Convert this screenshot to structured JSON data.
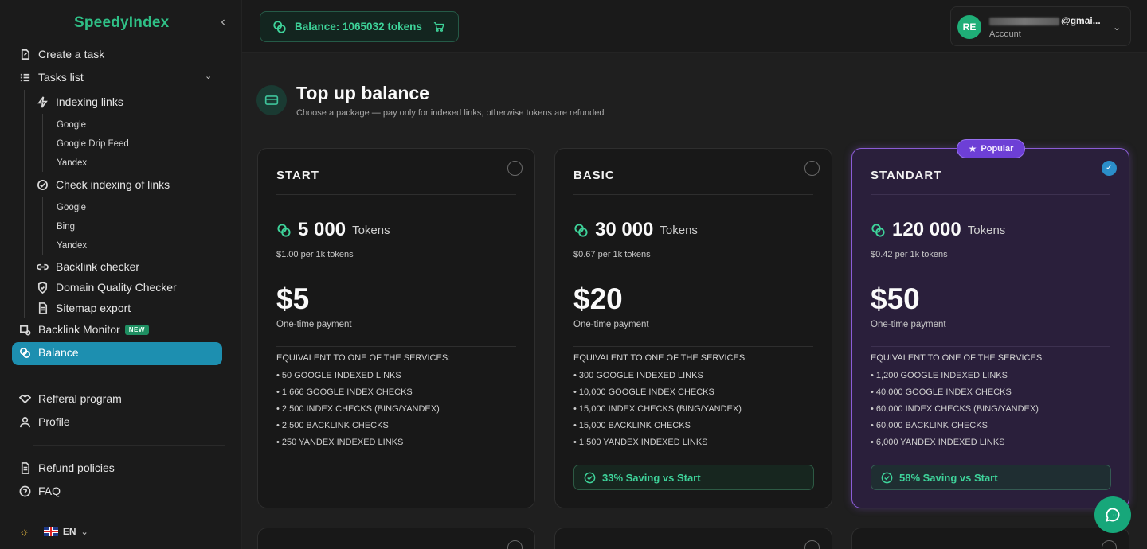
{
  "app": {
    "logo": "SpeedyIndex"
  },
  "sidebar": {
    "create_task": "Create a task",
    "tasks_list": "Tasks list",
    "indexing_links": "Indexing links",
    "indexing_sub": [
      "Google",
      "Google Drip Feed",
      "Yandex"
    ],
    "check_indexing": "Check indexing of links",
    "check_sub": [
      "Google",
      "Bing",
      "Yandex"
    ],
    "backlink_checker": "Backlink checker",
    "domain_quality": "Domain Quality Checker",
    "sitemap_export": "Sitemap export",
    "backlink_monitor": "Backlink Monitor",
    "new_badge": "NEW",
    "balance": "Balance",
    "referral": "Refferal program",
    "profile": "Profile",
    "refund": "Refund policies",
    "faq": "FAQ",
    "language": "EN"
  },
  "header": {
    "balance_label": "Balance: 1065032 tokens",
    "account_avatar": "RE",
    "account_email": "@gmai...",
    "account_label": "Account"
  },
  "page": {
    "title": "Top up balance",
    "subtitle": "Choose a package — pay only for indexed links, otherwise tokens are refunded"
  },
  "packages": [
    {
      "name": "START",
      "tokens": "5 000",
      "tokens_unit": "Tokens",
      "per": "$1.00 per 1k tokens",
      "price": "$5",
      "payment": "One-time payment",
      "equiv_head": "EQUIVALENT TO ONE OF THE SERVICES:",
      "items": [
        "• 50 GOOGLE INDEXED LINKS",
        "• 1,666 GOOGLE INDEX CHECKS",
        "• 2,500 INDEX CHECKS (BING/YANDEX)",
        "• 2,500 BACKLINK CHECKS",
        "• 250 YANDEX INDEXED LINKS"
      ],
      "selected": false
    },
    {
      "name": "BASIC",
      "tokens": "30 000",
      "tokens_unit": "Tokens",
      "per": "$0.67 per 1k tokens",
      "price": "$20",
      "payment": "One-time payment",
      "equiv_head": "EQUIVALENT TO ONE OF THE SERVICES:",
      "items": [
        "• 300 GOOGLE INDEXED LINKS",
        "• 10,000 GOOGLE INDEX CHECKS",
        "• 15,000 INDEX CHECKS (BING/YANDEX)",
        "• 15,000 BACKLINK CHECKS",
        "• 1,500 YANDEX INDEXED LINKS"
      ],
      "saving": "33% Saving vs Start",
      "selected": false
    },
    {
      "name": "STANDART",
      "popular": "Popular",
      "tokens": "120 000",
      "tokens_unit": "Tokens",
      "per": "$0.42 per 1k tokens",
      "price": "$50",
      "payment": "One-time payment",
      "equiv_head": "EQUIVALENT TO ONE OF THE SERVICES:",
      "items": [
        "• 1,200 GOOGLE INDEXED LINKS",
        "• 40,000 GOOGLE INDEX CHECKS",
        "• 60,000 INDEX CHECKS (BING/YANDEX)",
        "• 60,000 BACKLINK CHECKS",
        "• 6,000 YANDEX INDEXED LINKS"
      ],
      "saving": "58% Saving vs Start",
      "selected": true
    }
  ],
  "colors": {
    "accent": "#2fbf86",
    "active": "#1d8fb0",
    "selected_border": "#8b5cd6"
  }
}
